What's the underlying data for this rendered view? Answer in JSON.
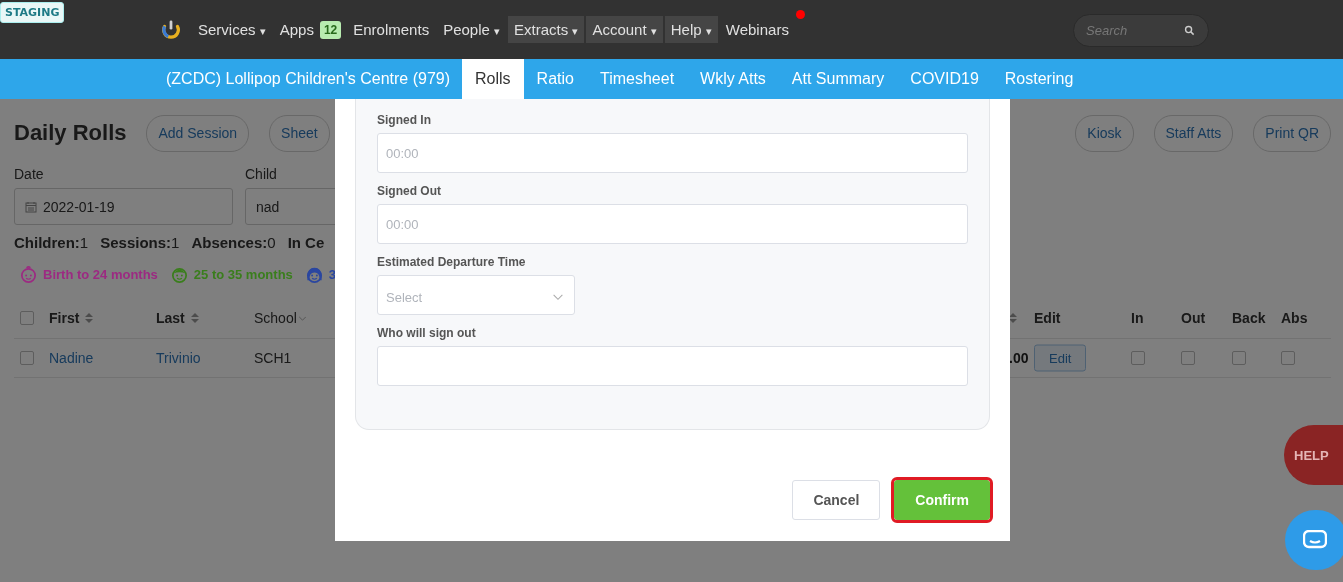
{
  "staging_badge": "STAGING",
  "nav": [
    {
      "label": "Services",
      "caret": "▾",
      "shaded": false
    },
    {
      "label": "Apps",
      "shaded": false,
      "badge": "12"
    },
    {
      "label": "Enrolments",
      "shaded": false
    },
    {
      "label": "People",
      "caret": "▾",
      "shaded": false
    },
    {
      "label": "Extracts",
      "caret": "▾",
      "shaded": true
    },
    {
      "label": "Account",
      "caret": "▾",
      "shaded": true
    },
    {
      "label": "Help",
      "caret": "▾",
      "shaded": true
    },
    {
      "label": "Webinars",
      "shaded": false,
      "notification": true
    }
  ],
  "search": {
    "placeholder": "Search"
  },
  "centre_name": "(ZCDC) Lollipop Children's Centre (979)",
  "tabs": [
    {
      "label": "Rolls",
      "selected": true
    },
    {
      "label": "Ratio",
      "selected": false
    },
    {
      "label": "Timesheet",
      "selected": false
    },
    {
      "label": "Wkly Atts",
      "selected": false
    },
    {
      "label": "Att Summary",
      "selected": false
    },
    {
      "label": "COVID19",
      "selected": false
    },
    {
      "label": "Rostering",
      "selected": false
    }
  ],
  "page_title": "Daily Rolls",
  "left_buttons": [
    "Add Session",
    "Sheet"
  ],
  "right_buttons": [
    "Kiosk",
    "Staff Atts",
    "Print QR"
  ],
  "filters": [
    {
      "label": "Date",
      "value": "2022-01-19",
      "kind": "date"
    },
    {
      "label": "Child",
      "value": "nad",
      "kind": "text"
    }
  ],
  "stats": [
    {
      "label": "Children:",
      "value": "1"
    },
    {
      "label": "Sessions:",
      "value": "1"
    },
    {
      "label": "Absences:",
      "value": "0"
    },
    {
      "label": "In Ce"
    }
  ],
  "legend": [
    {
      "label": "Birth to 24 months",
      "color": "#9c2a82",
      "kind": "baby"
    },
    {
      "label": "25 to 35 months",
      "color": "#3a7e1c",
      "kind": "toddler"
    },
    {
      "label": "3",
      "color": "#2a46a0",
      "kind": "girl"
    }
  ],
  "table": {
    "header_checked": false,
    "left_columns": [
      {
        "label": "First",
        "sort_arrows": true,
        "filter_caret": false
      },
      {
        "label": "Last",
        "sort_arrows": true,
        "filter_caret": false
      },
      {
        "label": "School",
        "sort_arrows": false,
        "filter_caret": true
      }
    ],
    "right_columns": [
      {
        "sort_arrows": true
      },
      {
        "label": "Edit",
        "sort_arrows": false
      },
      {
        "label": "In",
        "sort_arrows": false
      },
      {
        "label": "Out",
        "sort_arrows": false
      },
      {
        "label": "Back",
        "sort_arrows": false
      },
      {
        "label": "Abs",
        "sort_arrows": false
      }
    ],
    "rows": [
      {
        "checked": false,
        "first": "Nadine",
        "last": "Trivinio",
        "school": "SCH1",
        "partial": ".00",
        "edit": "Edit",
        "in": false,
        "out": false,
        "back": false,
        "abs": false
      }
    ]
  },
  "modal": {
    "fields": [
      {
        "label": "Signed In",
        "kind": "text",
        "placeholder": "00:00"
      },
      {
        "label": "Signed Out",
        "kind": "text",
        "placeholder": "00:00"
      },
      {
        "label": "Estimated Departure Time",
        "kind": "select",
        "placeholder": "Select"
      },
      {
        "label": "Who will sign out",
        "kind": "text"
      }
    ],
    "buttons": [
      {
        "label": "Cancel",
        "kind": "secondary",
        "highlighted": false
      },
      {
        "label": "Confirm",
        "kind": "primary",
        "highlighted": true
      }
    ]
  },
  "help_button": "HELP"
}
